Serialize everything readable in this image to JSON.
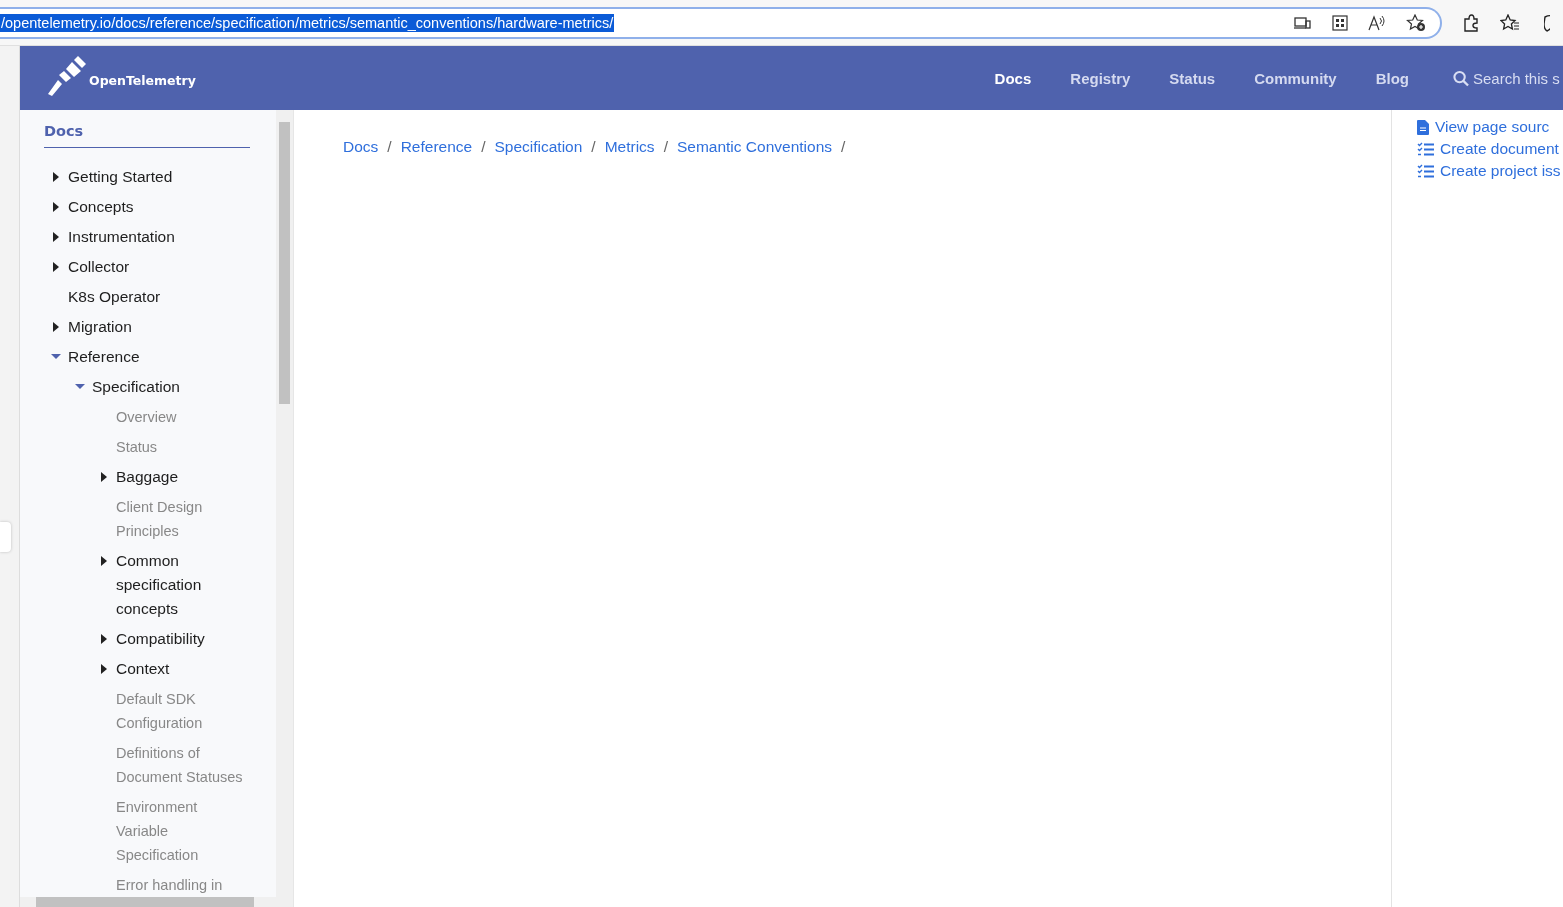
{
  "browser": {
    "url": "/opentelemetry.io/docs/reference/specification/metrics/semantic_conventions/hardware-metrics/",
    "url_selected": true
  },
  "header": {
    "logo": "OpenTelemetry",
    "nav": [
      {
        "label": "Docs",
        "selected": true
      },
      {
        "label": "Registry",
        "selected": false
      },
      {
        "label": "Status",
        "selected": false
      },
      {
        "label": "Community",
        "selected": false
      },
      {
        "label": "Blog",
        "selected": false
      }
    ],
    "search": {
      "placeholder": "Search this s"
    }
  },
  "sidebar": {
    "title": "Docs",
    "items": [
      {
        "label": "Getting Started",
        "kind": "section",
        "expanded": false
      },
      {
        "label": "Concepts",
        "kind": "section",
        "expanded": false
      },
      {
        "label": "Instrumentation",
        "kind": "section",
        "expanded": false
      },
      {
        "label": "Collector",
        "kind": "section",
        "expanded": false
      },
      {
        "label": "K8s Operator",
        "kind": "section"
      },
      {
        "label": "Migration",
        "kind": "section",
        "expanded": false
      },
      {
        "label": "Reference",
        "kind": "section",
        "expanded": true,
        "children": [
          {
            "label": "Specification",
            "kind": "section",
            "expanded": true,
            "children": [
              {
                "label": "Overview",
                "kind": "page"
              },
              {
                "label": "Status",
                "kind": "page"
              },
              {
                "label": "Baggage",
                "kind": "section",
                "expanded": false
              },
              {
                "label": "Client Design Principles",
                "kind": "page"
              },
              {
                "label": "Common specification concepts",
                "kind": "section",
                "expanded": false
              },
              {
                "label": "Compatibility",
                "kind": "section",
                "expanded": false
              },
              {
                "label": "Context",
                "kind": "section",
                "expanded": false
              },
              {
                "label": "Default SDK Configuration",
                "kind": "page"
              },
              {
                "label": "Definitions of Document Statuses",
                "kind": "page"
              },
              {
                "label": "Environment Variable Specification",
                "kind": "page"
              },
              {
                "label": "Error handling in",
                "kind": "page"
              }
            ]
          }
        ]
      }
    ]
  },
  "breadcrumb": [
    {
      "label": "Docs",
      "separator": "/"
    },
    {
      "label": "Reference",
      "separator": "/"
    },
    {
      "label": "Specification",
      "separator": "/"
    },
    {
      "label": "Metrics",
      "separator": "/"
    },
    {
      "label": "Semantic Conventions",
      "separator": "/"
    }
  ],
  "page_links": [
    {
      "label": "View page sourc",
      "kind": "source"
    },
    {
      "label": "Create document",
      "kind": "issue"
    },
    {
      "label": "Create project iss",
      "kind": "issue"
    }
  ]
}
